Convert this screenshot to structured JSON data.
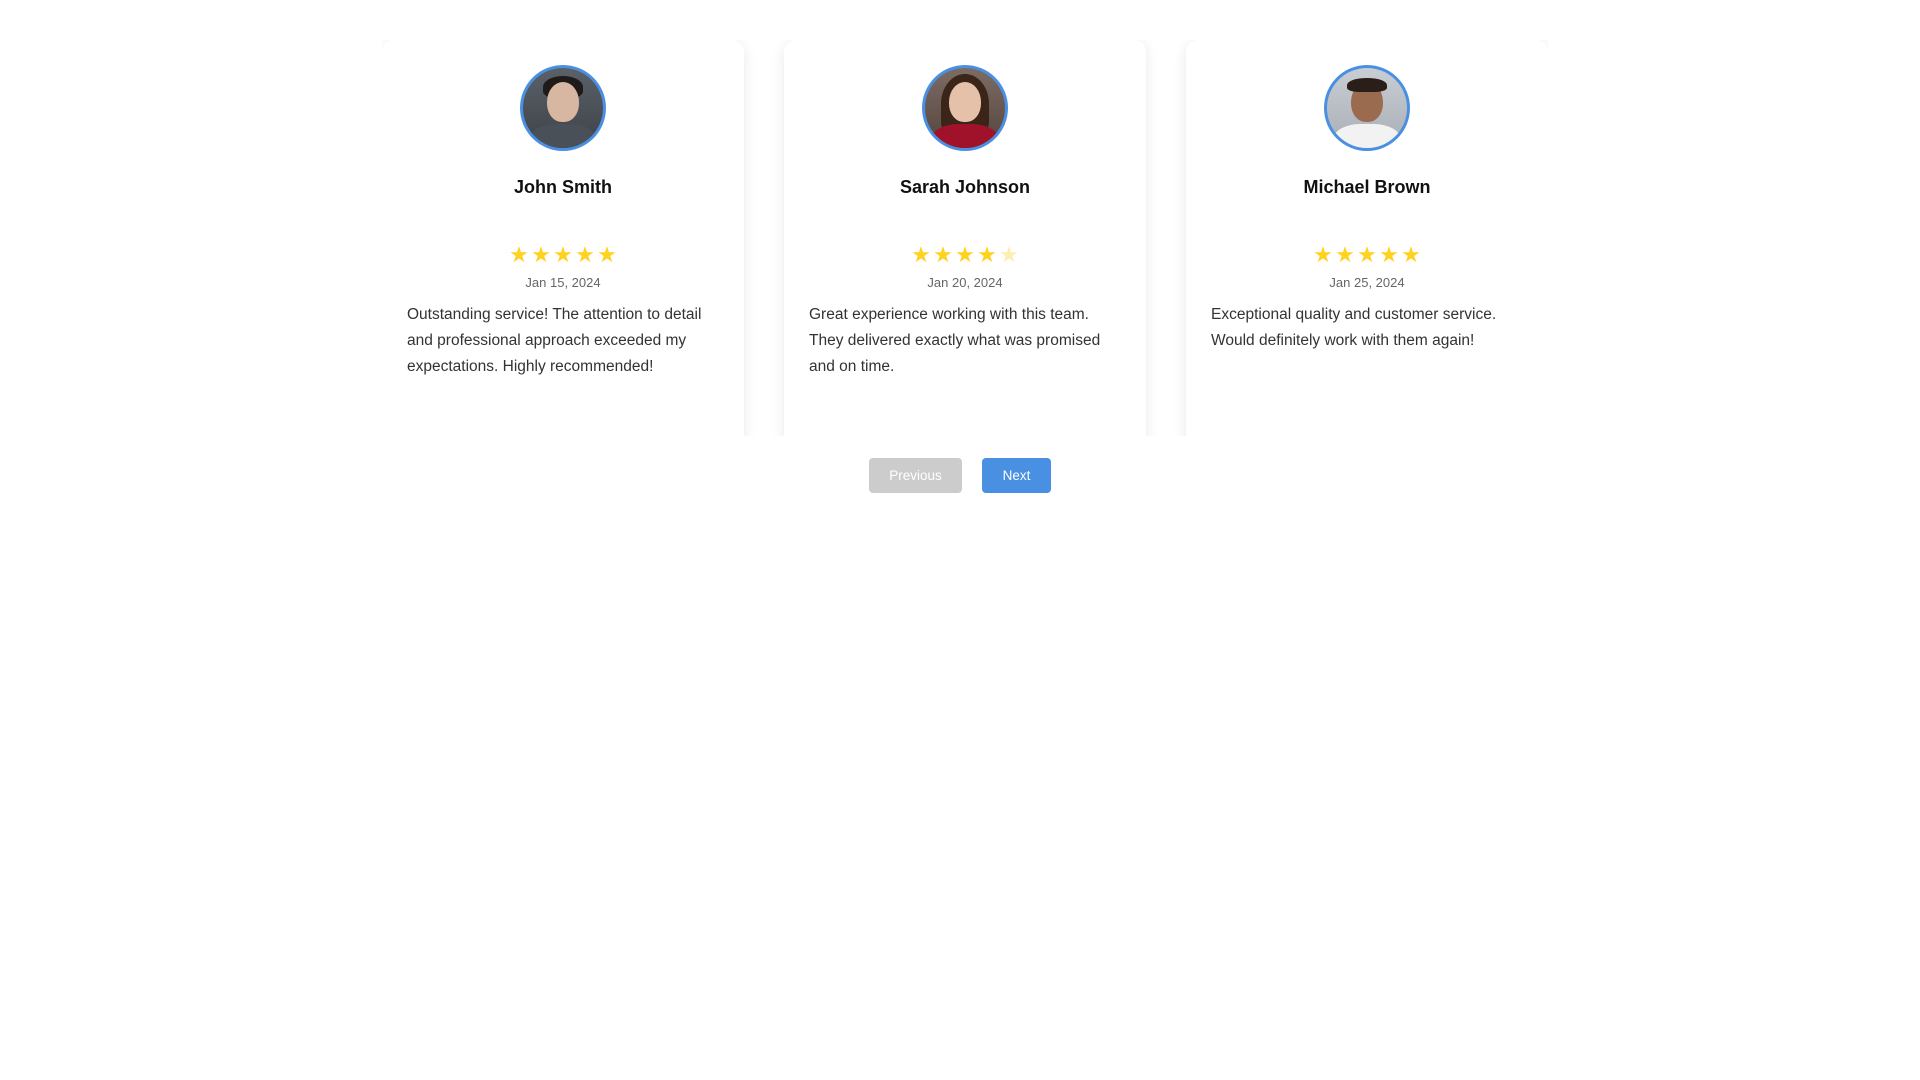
{
  "reviews": [
    {
      "name": "John Smith",
      "rating": 5,
      "stars": [
        "★",
        "★",
        "★",
        "★",
        "★"
      ],
      "date": "Jan 15, 2024",
      "text": "Outstanding service! The attention to detail and professional approach exceeded my expectations. Highly recommended!"
    },
    {
      "name": "Sarah Johnson",
      "rating": 4,
      "stars": [
        "★",
        "★",
        "★",
        "★",
        "★"
      ],
      "date": "Jan 20, 2024",
      "text": "Great experience working with this team. They delivered exactly what was promised and on time."
    },
    {
      "name": "Michael Brown",
      "rating": 5,
      "stars": [
        "★",
        "★",
        "★",
        "★",
        "★"
      ],
      "date": "Jan 25, 2024",
      "text": "Exceptional quality and customer service. Would definitely work with them again!"
    }
  ],
  "controls": {
    "previous_label": "Previous",
    "next_label": "Next",
    "previous_disabled": true
  },
  "colors": {
    "accent": "#4a90e2",
    "star": "#ffd21f",
    "star_empty": "#fbeeb0",
    "disabled_button": "#cccccc"
  },
  "icons": {
    "star": "star-icon"
  }
}
